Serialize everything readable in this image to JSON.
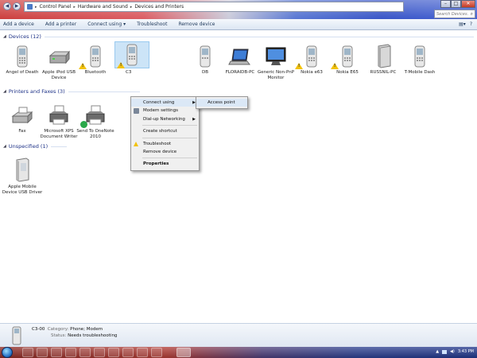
{
  "address": {
    "crumbs": [
      "Control Panel",
      "Hardware and Sound",
      "Devices and Printers"
    ]
  },
  "search": {
    "placeholder": "Search Devices..."
  },
  "toolbar": {
    "add_device": "Add a device",
    "add_printer": "Add a printer",
    "connect_using": "Connect using",
    "troubleshoot": "Troubleshoot",
    "remove_device": "Remove device"
  },
  "groups": {
    "devices": "Devices (12)",
    "printers": "Printers and Faxes (3)",
    "unspecified": "Unspecified (1)"
  },
  "devices": [
    {
      "name": "Angel of Death"
    },
    {
      "name": "Apple iPod USB Device"
    },
    {
      "name": "Bluetooth"
    },
    {
      "name": "C3"
    },
    {
      "name": "DB"
    },
    {
      "name": "FLORAIDB-PC"
    },
    {
      "name": "Generic Non-PnP Monitor"
    },
    {
      "name": "Nokia e63"
    },
    {
      "name": "Nokia E65"
    },
    {
      "name": "RUSSNIL-PC"
    },
    {
      "name": "T-Mobile Dash"
    }
  ],
  "printers": [
    {
      "name": "Fax"
    },
    {
      "name": "Microsoft XPS Document Writer"
    },
    {
      "name": "Send To OneNote 2010"
    }
  ],
  "unspecified": [
    {
      "name": "Apple Mobile Device USB Driver"
    }
  ],
  "context_menu": {
    "connect_using": "Connect using",
    "modem_settings": "Modem settings",
    "dialup": "Dial-up Networking",
    "create_shortcut": "Create shortcut",
    "troubleshoot": "Troubleshoot",
    "remove_device": "Remove device",
    "properties": "Properties"
  },
  "submenu": {
    "access_point": "Access point"
  },
  "details": {
    "name": "C3-00",
    "category_label": "Category:",
    "category_value": "Phone; Modem",
    "status_label": "Status:",
    "status_value": "Needs troubleshooting"
  },
  "taskbar": {
    "clock": "3:43 PM"
  },
  "colors": {
    "group_header": "#1e3287",
    "selection": "#cce4f7",
    "warning": "#f2c20c"
  }
}
